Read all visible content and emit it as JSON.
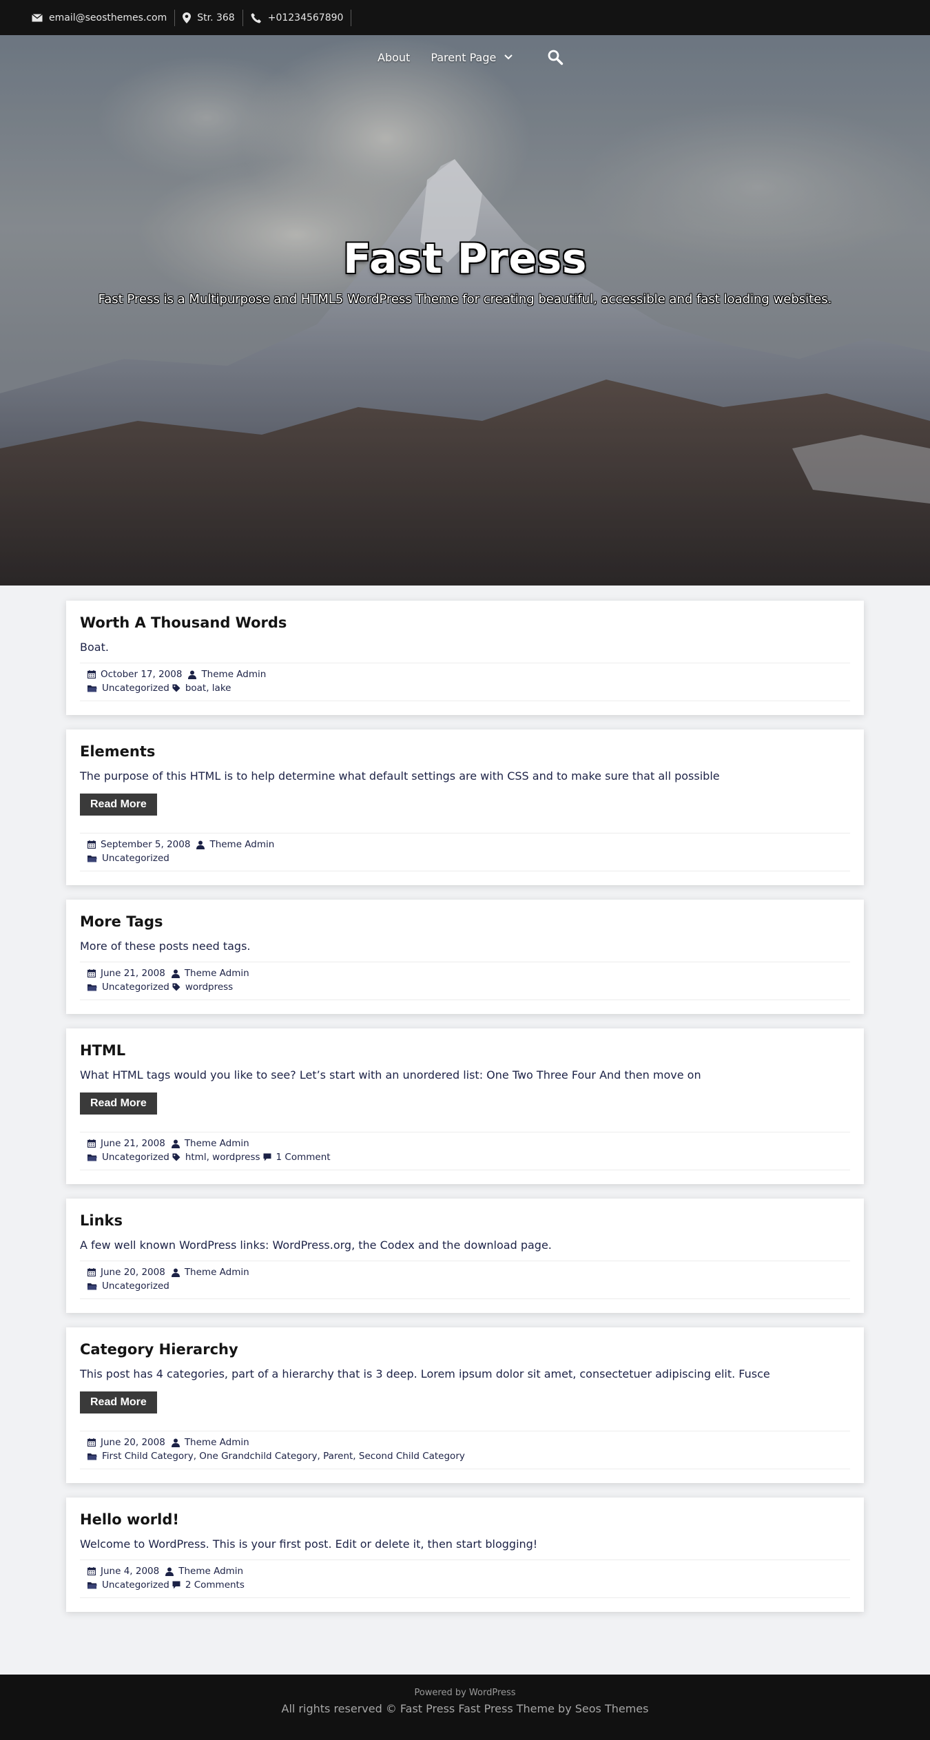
{
  "topbar": {
    "email": "email@seosthemes.com",
    "address": "Str. 368",
    "phone": "+01234567890"
  },
  "nav": {
    "items": [
      "About",
      "Parent Page"
    ]
  },
  "hero": {
    "title": "Fast Press",
    "description": "Fast Press is a Multipurpose and HTML5 WordPress Theme for creating beautiful, accessible and fast loading websites."
  },
  "read_more_label": "Read More",
  "posts": [
    {
      "title": "Worth A Thousand Words",
      "excerpt": "Boat.",
      "date": "October 17, 2008",
      "author": "Theme Admin",
      "categories": "Uncategorized",
      "tags": "boat, lake"
    },
    {
      "title": "Elements",
      "excerpt": "The purpose of this HTML is to help determine what default settings are with CSS and to make sure that all possible",
      "date": "September 5, 2008",
      "author": "Theme Admin",
      "categories": "Uncategorized"
    },
    {
      "title": "More Tags",
      "excerpt": "More of these posts need tags.",
      "date": "June 21, 2008",
      "author": "Theme Admin",
      "categories": "Uncategorized",
      "tags": "wordpress"
    },
    {
      "title": "HTML",
      "excerpt": "What HTML tags would you like to see? Let’s start with an unordered list: One Two Three Four And then move on",
      "date": "June 21, 2008",
      "author": "Theme Admin",
      "categories": "Uncategorized",
      "tags": "html, wordpress",
      "comments": "1 Comment"
    },
    {
      "title": "Links",
      "excerpt": "A few well known WordPress links: WordPress.org, the Codex and the download page.",
      "date": "June 20, 2008",
      "author": "Theme Admin",
      "categories": "Uncategorized"
    },
    {
      "title": "Category Hierarchy",
      "excerpt": "This post has 4 categories, part of a hierarchy that is 3 deep. Lorem ipsum dolor sit amet, consectetuer adipiscing elit. Fusce",
      "date": "June 20, 2008",
      "author": "Theme Admin",
      "categories": "First Child Category, One Grandchild Category, Parent, Second Child Category"
    },
    {
      "title": "Hello world!",
      "excerpt": "Welcome to WordPress. This is your first post. Edit or delete it, then start blogging!",
      "date": "June 4, 2008",
      "author": "Theme Admin",
      "categories": "Uncategorized",
      "comments": "2 Comments"
    }
  ],
  "footer": {
    "powered": "Powered by WordPress",
    "rights": "All rights reserved © Fast Press Fast Press Theme by Seos Themes"
  },
  "colors": {
    "topbar_bg": "#131313",
    "footer_bg": "#111111",
    "button_bg": "#3a3a3a",
    "text": "#1c2246"
  },
  "icons": [
    "email-icon",
    "map-pin-icon",
    "phone-icon",
    "chevron-down-icon",
    "search-icon",
    "calendar-icon",
    "user-icon",
    "folder-icon",
    "tag-icon",
    "comment-icon"
  ]
}
